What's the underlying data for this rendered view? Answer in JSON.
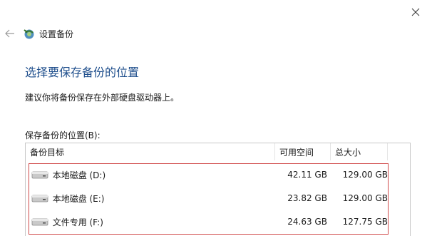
{
  "nav": {
    "title": "设置备份"
  },
  "page": {
    "heading": "选择要保存备份的位置",
    "instruction": "建议你将备份保存在外部硬盘驱动器上。",
    "list_label": "保存备份的位置(B):"
  },
  "table": {
    "columns": [
      "备份目标",
      "可用空间",
      "总大小"
    ],
    "rows": [
      {
        "name": "本地磁盘 (D:)",
        "free": "42.11 GB",
        "total": "129.00 GB",
        "icon": "drive-icon"
      },
      {
        "name": "本地磁盘 (E:)",
        "free": "23.82 GB",
        "total": "129.00 GB",
        "icon": "drive-icon"
      },
      {
        "name": "文件专用 (F:)",
        "free": "24.63 GB",
        "total": "127.75 GB",
        "icon": "drive-icon"
      }
    ]
  },
  "colors": {
    "heading": "#1e4e8c",
    "selection_border": "#d04a4a",
    "list_border": "#c7c7c7"
  },
  "icons": {
    "close": "close-icon",
    "back": "back-arrow-icon",
    "app": "backup-icon"
  }
}
